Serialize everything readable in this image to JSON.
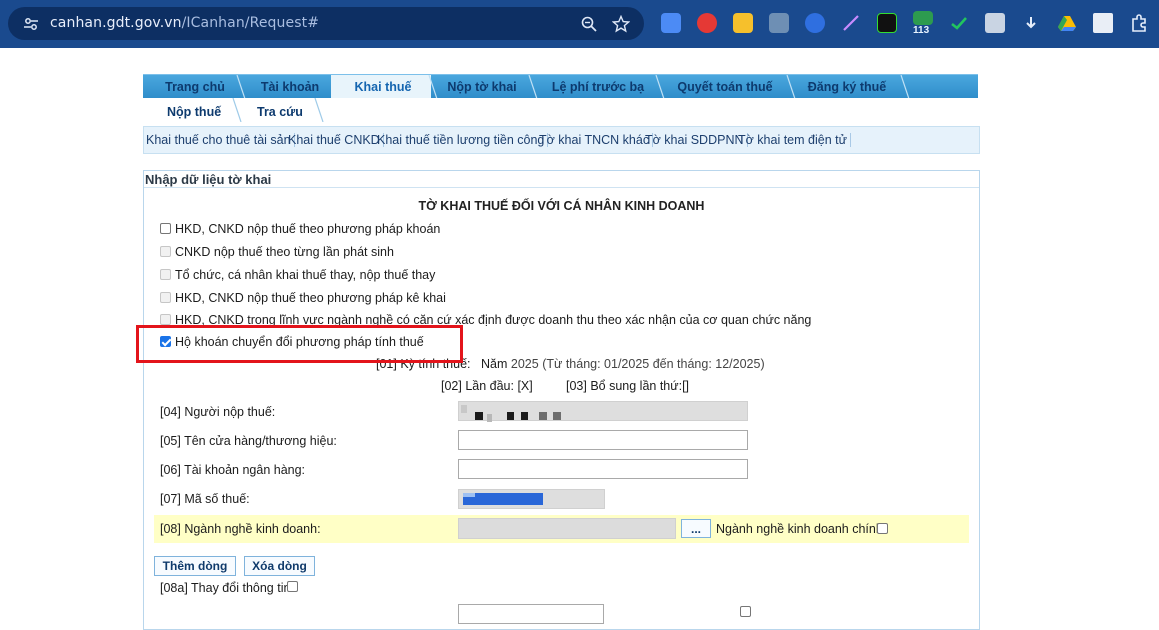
{
  "browser": {
    "url_host": "canhan.gdt.gov.vn",
    "url_path": "/ICanhan/Request#",
    "ext_badge": "113"
  },
  "nav": {
    "main_tabs": [
      "Trang chủ",
      "Tài khoản",
      "Khai thuế",
      "Nộp tờ khai",
      "Lệ phí trước bạ",
      "Quyết toán thuế",
      "Đăng ký thuế"
    ],
    "active_tab": "Khai thuế",
    "row2_tabs": [
      "Nộp thuế",
      "Tra cứu"
    ],
    "sub_tabs": [
      "Khai thuế cho thuê tài sản",
      "Khai thuế CNKD",
      "Khai thuế tiền lương tiền công",
      "Tờ khai TNCN khác",
      "Tờ khai SDDPNN",
      "Tờ khai tem điện tử"
    ]
  },
  "panel": {
    "heading": "Nhập dữ liệu tờ khai",
    "form_title": "TỜ KHAI THUẾ ĐỐI VỚI CÁ NHÂN KINH DOANH",
    "options": [
      {
        "label": "HKD, CNKD nộp thuế theo phương pháp khoán",
        "checked": false,
        "disabled": false
      },
      {
        "label": "CNKD nộp thuế theo từng lần phát sinh",
        "checked": false,
        "disabled": true
      },
      {
        "label": "Tổ chức, cá nhân khai thuế thay, nộp thuế thay",
        "checked": false,
        "disabled": true
      },
      {
        "label": "HKD, CNKD nộp thuế theo phương pháp kê khai",
        "checked": false,
        "disabled": true
      },
      {
        "label": "HKD, CNKD trong lĩnh vực ngành nghề có căn cứ xác định được doanh thu theo xác nhận của cơ quan chức năng",
        "checked": false,
        "disabled": true
      },
      {
        "label": "Hộ khoán chuyển đổi phương pháp tính thuế",
        "checked": true,
        "disabled": false
      }
    ],
    "period_label": "[01] Kỳ tính thuế:",
    "period_year_prefix": "Năm",
    "period_year": "2025",
    "period_range": "(Từ tháng: 01/2025 đến tháng: 12/2025)",
    "first_time": "[02] Lần đầu: [X]",
    "supplement": "[03] Bổ sung lần thứ:[]",
    "taxpayer_label": "[04] Người nộp thuế:",
    "store_label": "[05] Tên cửa hàng/thương hiệu:",
    "bank_label": "[06] Tài khoản ngân hàng:",
    "taxcode_label": "[07] Mã số thuế:",
    "industry_label": "[08] Ngành nghề kinh doanh:",
    "browse_button": "...",
    "main_industry_label": "Ngành nghề kinh doanh chính",
    "add_row_button": "Thêm dòng",
    "delete_row_button": "Xóa dòng",
    "change_info_label": "[08a] Thay đổi thông tin"
  }
}
